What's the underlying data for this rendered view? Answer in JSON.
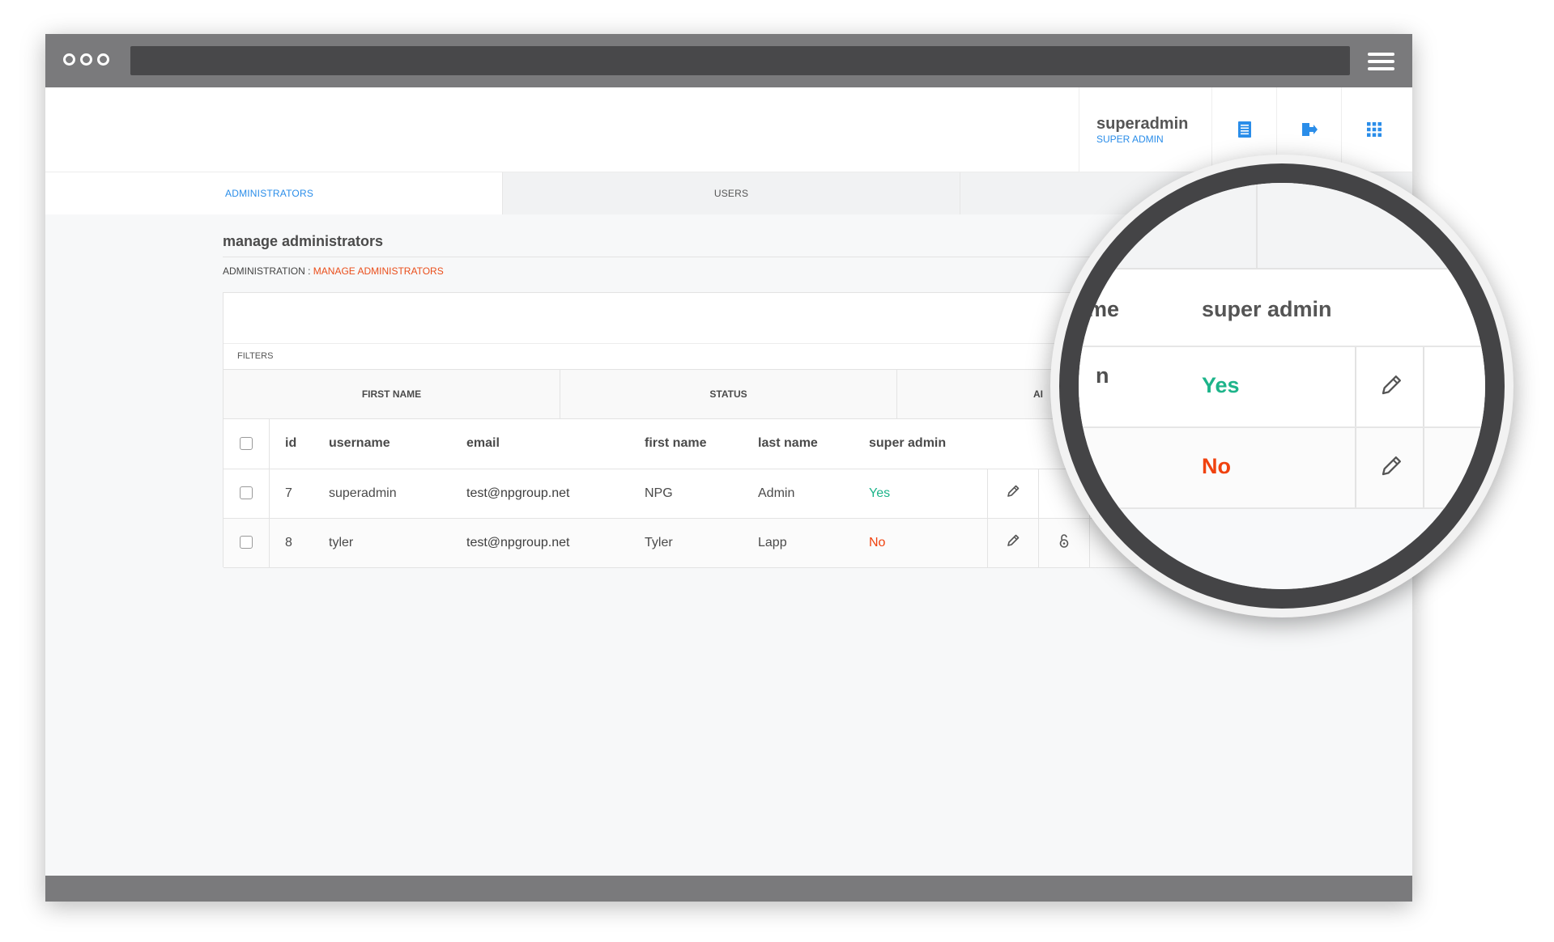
{
  "header": {
    "user_name": "superadmin",
    "user_role": "SUPER ADMIN",
    "icons": [
      "document-icon",
      "logout-icon",
      "apps-grid-icon"
    ]
  },
  "tabs": [
    {
      "label": "ADMINISTRATORS",
      "active": true
    },
    {
      "label": "USERS",
      "active": false
    },
    {
      "label": "",
      "active": false
    }
  ],
  "page": {
    "title": "manage administrators",
    "breadcrumb_root": "ADMINISTRATION",
    "breadcrumb_sep": " : ",
    "breadcrumb_current": "MANAGE ADMINISTRATORS"
  },
  "filters": {
    "label": "FILTERS",
    "columns": [
      "FIRST NAME",
      "STATUS",
      "AI"
    ]
  },
  "table": {
    "headers": {
      "id": "id",
      "username": "username",
      "email": "email",
      "first_name": "first name",
      "last_name": "last name",
      "super_admin": "super admin"
    },
    "rows": [
      {
        "id": "7",
        "username": "superadmin",
        "email": "test@npgroup.net",
        "first_name": "NPG",
        "last_name": "Admin",
        "super_admin": "Yes"
      },
      {
        "id": "8",
        "username": "tyler",
        "email": "test@npgroup.net",
        "first_name": "Tyler",
        "last_name": "Lapp",
        "super_admin": "No"
      }
    ]
  },
  "magnifier": {
    "header_fragment": "me",
    "header_super": "super admin",
    "row_fragment": "n",
    "row1_value": "Yes",
    "row2_value": "No"
  },
  "colors": {
    "accent": "#2a8de9",
    "breadcrumb_active": "#ea4e1b",
    "yes": "#1db48a",
    "no": "#f0420f",
    "frame": "#7a7a7c",
    "lens_ring": "#444446"
  }
}
